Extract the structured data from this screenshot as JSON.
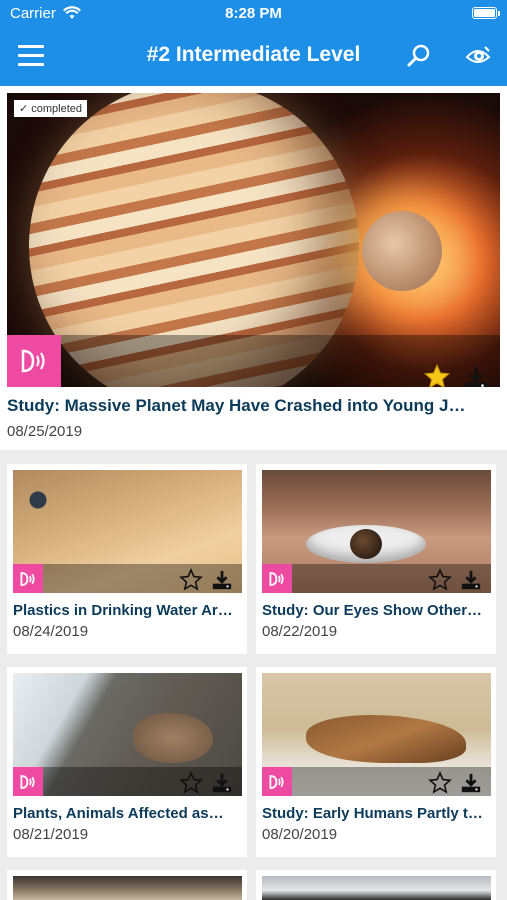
{
  "status_bar": {
    "carrier": "Carrier",
    "time": "8:28 PM"
  },
  "nav": {
    "title": "#2 Intermediate Level",
    "menu_icon": "hamburger-menu-icon",
    "search_icon": "search-icon",
    "view_icon": "eye-icon"
  },
  "featured": {
    "badge": "✓ completed",
    "title": "Study: Massive Planet May Have Crashed into Young J…",
    "date": "08/25/2019",
    "favorited": true
  },
  "articles": [
    {
      "title": "Plastics in Drinking Water Ar…",
      "date": "08/24/2019"
    },
    {
      "title": "Study: Our Eyes Show Other…",
      "date": "08/22/2019"
    },
    {
      "title": "Plants, Animals Affected as…",
      "date": "08/21/2019"
    },
    {
      "title": "Study: Early Humans Partly t…",
      "date": "08/20/2019"
    }
  ],
  "colors": {
    "brand_blue": "#1e8fe6",
    "audio_pink": "#ee4aa2",
    "title_navy": "#0c3b59",
    "star_gold": "#f5c518"
  }
}
